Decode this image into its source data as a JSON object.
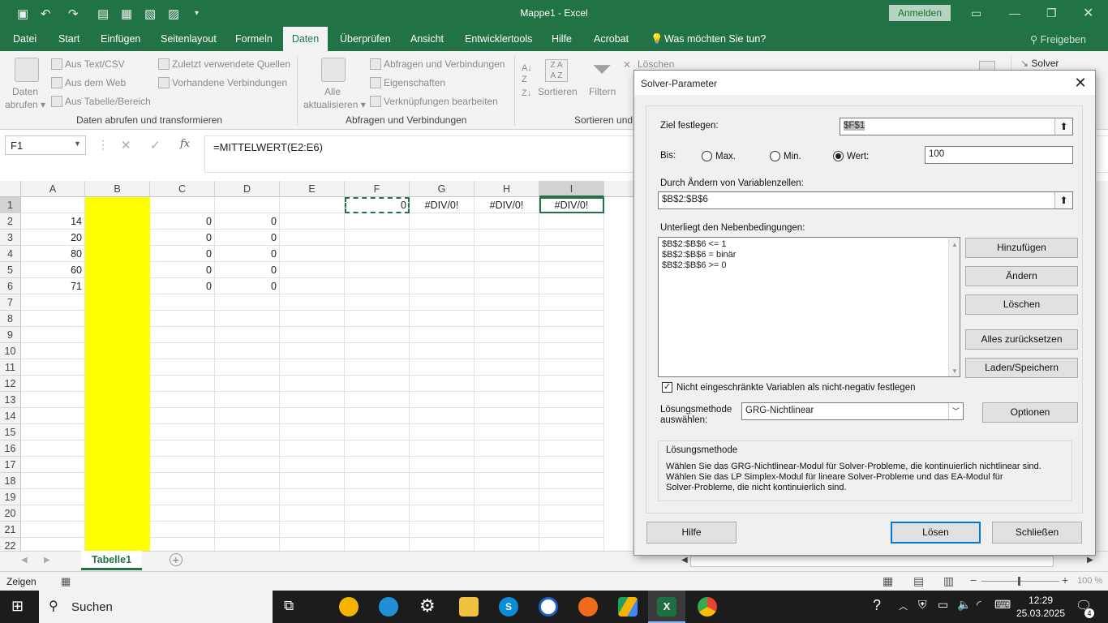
{
  "window": {
    "title": "Mappe1 - Excel",
    "signin": "Anmelden"
  },
  "tabs": [
    "Datei",
    "Start",
    "Einfügen",
    "Seitenlayout",
    "Formeln",
    "Daten",
    "Überprüfen",
    "Ansicht",
    "Entwicklertools",
    "Hilfe",
    "Acrobat"
  ],
  "active_tab": "Daten",
  "tell_me": "Was möchten Sie tun?",
  "share": "Freigeben",
  "ribbon": {
    "get_data": [
      "Daten",
      "abrufen"
    ],
    "from_text": "Aus Text/CSV",
    "from_web": "Aus dem Web",
    "from_table": "Aus Tabelle/Bereich",
    "recent_sources": "Zuletzt verwendete Quellen",
    "existing_connections": "Vorhandene Verbindungen",
    "group1": "Daten abrufen und transformieren",
    "refresh_all": [
      "Alle",
      "aktualisieren"
    ],
    "queries_connections": "Abfragen und Verbindungen",
    "properties": "Eigenschaften",
    "edit_links": "Verknüpfungen bearbeiten",
    "group2": "Abfragen und Verbindungen",
    "sort": "Sortieren",
    "filter": "Filtern",
    "clear": "Löschen",
    "group3": "Sortieren und",
    "solver": "Solver"
  },
  "namebox": "F1",
  "formula": "=MITTELWERT(E2:E6)",
  "columns": [
    "A",
    "B",
    "C",
    "D",
    "E",
    "F",
    "G",
    "H",
    "I"
  ],
  "rows": [
    "1",
    "2",
    "3",
    "4",
    "5",
    "6",
    "7",
    "8",
    "9",
    "10",
    "11",
    "12",
    "13",
    "14",
    "15",
    "16",
    "17",
    "18",
    "19",
    "20",
    "21",
    "22"
  ],
  "cells": {
    "A": [
      "",
      "14",
      "20",
      "80",
      "60",
      "71"
    ],
    "C": [
      "",
      "0",
      "0",
      "0",
      "0",
      "0"
    ],
    "D": [
      "",
      "0",
      "0",
      "0",
      "0",
      "0"
    ],
    "F": [
      "0"
    ],
    "G": [
      "#DIV/0!"
    ],
    "H": [
      "#DIV/0!"
    ],
    "I": [
      "#DIV/0!"
    ]
  },
  "sheet_tab": "Tabelle1",
  "status": {
    "mode": "Zeigen",
    "zoom": "100 %"
  },
  "taskbar": {
    "search": "Suchen",
    "time": "12:29",
    "date": "25.03.2025",
    "notifications": "4"
  },
  "dialog": {
    "title": "Solver-Parameter",
    "objective_label": "Ziel festlegen:",
    "objective_value": "$F$1",
    "to_label": "Bis:",
    "opt_max": "Max.",
    "opt_min": "Min.",
    "opt_value": "Wert:",
    "value": "100",
    "variables_label": "Durch Ändern von Variablenzellen:",
    "variables_value": "$B$2:$B$6",
    "constraints_label": "Unterliegt den Nebenbedingungen:",
    "constraints": [
      "$B$2:$B$6 <= 1",
      "$B$2:$B$6 = binär",
      "$B$2:$B$6 >= 0"
    ],
    "btn_add": "Hinzufügen",
    "btn_change": "Ändern",
    "btn_delete": "Löschen",
    "btn_reset": "Alles zurücksetzen",
    "btn_load": "Laden/Speichern",
    "nonneg_label": "Nicht eingeschränkte Variablen als nicht-negativ festlegen",
    "method_label": [
      "Lösungsmethode",
      "auswählen:"
    ],
    "method_value": "GRG-Nichtlinear",
    "btn_options": "Optionen",
    "desc_title": "Lösungsmethode",
    "desc_text": [
      "Wählen Sie das GRG-Nichtlinear-Modul für Solver-Probleme, die kontinuierlich nichtlinear sind.",
      "Wählen Sie das LP Simplex-Modul für lineare Solver-Probleme und das EA-Modul für",
      "Solver-Probleme, die nicht kontinuierlich sind."
    ],
    "btn_help": "Hilfe",
    "btn_solve": "Lösen",
    "btn_close": "Schließen"
  }
}
